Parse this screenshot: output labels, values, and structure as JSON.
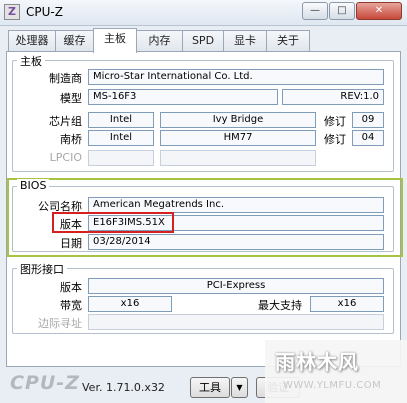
{
  "window": {
    "title": "CPU-Z",
    "app_icon": "cpuz-icon",
    "minimize": "—",
    "maximize": "□",
    "close": "✕"
  },
  "tabs": [
    {
      "label": "处理器"
    },
    {
      "label": "缓存"
    },
    {
      "label": "主板"
    },
    {
      "label": "内存"
    },
    {
      "label": "SPD"
    },
    {
      "label": "显卡"
    },
    {
      "label": "关于"
    }
  ],
  "motherboard": {
    "legend": "主板",
    "manufacturer_label": "制造商",
    "manufacturer": "Micro-Star International Co. Ltd.",
    "model_label": "模型",
    "model": "MS-16F3",
    "rev": "REV:1.0",
    "chipset_label": "芯片组",
    "chipset_vendor": "Intel",
    "chipset_name": "Ivy Bridge",
    "chipset_rev_label": "修订",
    "chipset_rev": "09",
    "southbridge_label": "南桥",
    "southbridge_vendor": "Intel",
    "southbridge_name": "HM77",
    "southbridge_rev_label": "修订",
    "southbridge_rev": "04",
    "lpcio_label": "LPCIO"
  },
  "bios": {
    "legend": "BIOS",
    "brand_label": "公司名称",
    "brand": "American Megatrends Inc.",
    "version_label": "版本",
    "version": "E16F3IMS.51X",
    "date_label": "日期",
    "date": "03/28/2014"
  },
  "graphic_interface": {
    "legend": "图形接口",
    "version_label": "版本",
    "version": "PCI-Express",
    "link_width_label": "带宽",
    "link_width": "x16",
    "max_supported_label": "最大支持",
    "max_supported": "x16",
    "side_band_label": "边际寻址"
  },
  "footer": {
    "logo": "CPU-Z",
    "version": "Ver. 1.71.0.x32",
    "tools_button": "工具",
    "tools_arrow": "▼",
    "validate_button": "验证"
  },
  "watermark": {
    "main": "雨林木风",
    "url": "WWW.YLMFU.COM"
  },
  "colors": {
    "highlight_green": "#a6c442",
    "highlight_red": "#d62020"
  }
}
